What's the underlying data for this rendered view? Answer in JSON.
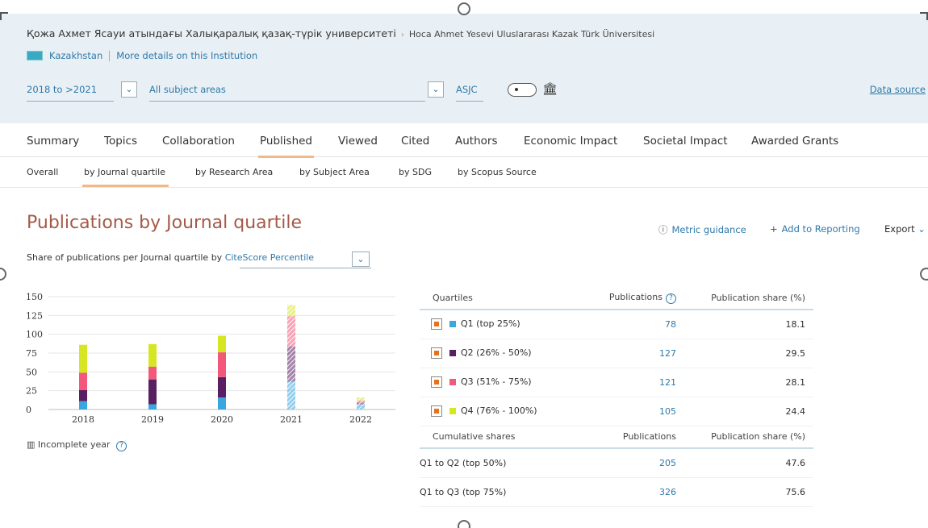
{
  "institution": {
    "name": "Қожа Ахмет Ясауи атындағы Халықаралық қазақ-түрік университеті",
    "alt_name": "Hoca Ahmet Yesevi Uluslararası Kazak Türk Üniversitesi",
    "country": "Kazakhstan",
    "details_link": "More details on this Institution"
  },
  "filters": {
    "year_range": "2018 to >2021",
    "subject_areas": "All subject areas",
    "classification": "ASJC",
    "data_source": "Data source"
  },
  "tabs": [
    "Summary",
    "Topics",
    "Collaboration",
    "Published",
    "Viewed",
    "Cited",
    "Authors",
    "Economic Impact",
    "Societal Impact",
    "Awarded Grants"
  ],
  "active_tab": "Published",
  "subtabs": [
    "Overall",
    "by Journal quartile",
    "by Research Area",
    "by Subject Area",
    "by SDG",
    "by Scopus Source"
  ],
  "active_subtab": "by Journal quartile",
  "page": {
    "title": "Publications by Journal quartile",
    "metric_guidance": "Metric guidance",
    "add_to_reporting": "Add to Reporting",
    "export": "Export",
    "share_label": "Share of publications per Journal quartile by",
    "share_metric": "CiteScore Percentile",
    "incomplete_year": "Incomplete year"
  },
  "colors": {
    "Q1": "#3aa6e0",
    "Q2": "#5a1f63",
    "Q3": "#f2587a",
    "Q4": "#d6e622",
    "checkbox_accent": "#e8711c",
    "title": "#a45a48",
    "link": "#2f79a8"
  },
  "chart_data": {
    "type": "bar",
    "stacked": true,
    "categories": [
      "2018",
      "2019",
      "2020",
      "2021",
      "2022"
    ],
    "incomplete_categories": [
      "2021",
      "2022"
    ],
    "ylim": [
      0,
      150
    ],
    "yticks": [
      "150",
      "125",
      "100",
      "75",
      "50",
      "25",
      "0"
    ],
    "series": [
      {
        "name": "Q1 (top 25%)",
        "values": [
          11,
          7,
          16,
          37,
          7
        ]
      },
      {
        "name": "Q2 (26% - 50%)",
        "values": [
          15,
          33,
          27,
          47,
          2
        ]
      },
      {
        "name": "Q3 (51% - 75%)",
        "values": [
          23,
          17,
          33,
          40,
          3
        ]
      },
      {
        "name": "Q4 (76% - 100%)",
        "values": [
          37,
          30,
          22,
          15,
          4
        ]
      }
    ]
  },
  "quartile_table": {
    "headers": [
      "Quartiles",
      "Publications",
      "Publication share (%)"
    ],
    "rows": [
      {
        "label": "Q1 (top 25%)",
        "publications": "78",
        "share": "18.1"
      },
      {
        "label": "Q2 (26% - 50%)",
        "publications": "127",
        "share": "29.5"
      },
      {
        "label": "Q3 (51% - 75%)",
        "publications": "121",
        "share": "28.1"
      },
      {
        "label": "Q4 (76% - 100%)",
        "publications": "105",
        "share": "24.4"
      }
    ]
  },
  "cumulative_table": {
    "headers": [
      "Cumulative shares",
      "Publications",
      "Publication share (%)"
    ],
    "rows": [
      {
        "label": "Q1 to Q2 (top 50%)",
        "publications": "205",
        "share": "47.6"
      },
      {
        "label": "Q1 to Q3 (top 75%)",
        "publications": "326",
        "share": "75.6"
      }
    ]
  }
}
